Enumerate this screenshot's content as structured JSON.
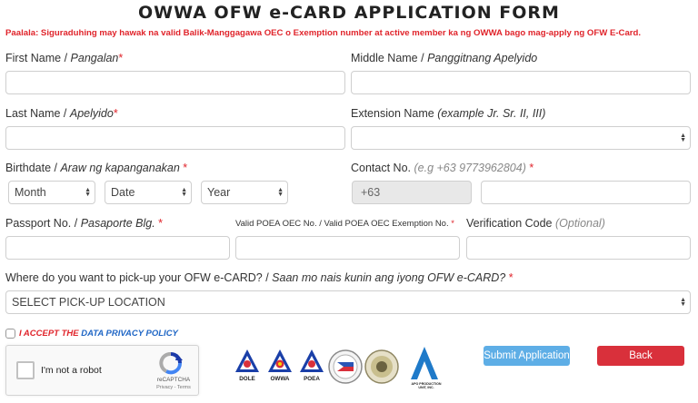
{
  "form": {
    "title": "OWWA OFW e-CARD APPLICATION FORM",
    "notice": "Paalala: Siguraduhing may hawak na valid Balik-Manggagawa OEC o Exemption number at active member ka ng OWWA bago mag-apply ng OFW E-Card."
  },
  "fields": {
    "first_name": {
      "label": "First Name / ",
      "label_tl": "Pangalan",
      "required": "*",
      "value": ""
    },
    "middle_name": {
      "label": "Middle Name / ",
      "label_tl": "Panggitnang Apelyido",
      "value": ""
    },
    "last_name": {
      "label": "Last Name / ",
      "label_tl": "Apelyido",
      "required": "*",
      "value": ""
    },
    "extension_name": {
      "label": "Extension Name ",
      "label_tl": "(example Jr. Sr. II, III)",
      "value": ""
    },
    "birthdate": {
      "label": "Birthdate / ",
      "label_tl": "Araw ng kapanganakan",
      "required": "*",
      "month": "Month",
      "day": "Date",
      "year": "Year"
    },
    "contact": {
      "label": "Contact No. ",
      "hint": "(e.g +63 9773962804)",
      "required": "*",
      "prefix": "+63",
      "value": ""
    },
    "passport": {
      "label": "Passport No. / ",
      "label_tl": "Pasaporte Blg.",
      "required": "*",
      "value": ""
    },
    "oec": {
      "label": "Valid POEA OEC No. / Valid POEA OEC Exemption No.",
      "required": "*",
      "value": ""
    },
    "verification": {
      "label": "Verification Code ",
      "hint": "(Optional)",
      "value": ""
    },
    "pickup": {
      "label": "Where do you want to pick-up your OFW e-CARD? / ",
      "label_tl": "Saan mo nais kunin ang iyong OFW e-CARD?",
      "required": "*",
      "selected": "SELECT PICK-UP LOCATION"
    }
  },
  "privacy": {
    "prefix": "I ACCEPT THE ",
    "link": "DATA PRIVACY POLICY"
  },
  "recaptcha": {
    "label": "I'm not a robot",
    "brand": "reCAPTCHA",
    "terms": "Privacy - Terms"
  },
  "logos": {
    "dole": "DOLE",
    "owwa": "OWWA",
    "poea": "POEA",
    "apo": "APO PRODUCTION UNIT, INC."
  },
  "buttons": {
    "submit": "Submit Application",
    "back": "Back"
  },
  "colors": {
    "required": "#e0242b",
    "link": "#1f66c5",
    "submit": "#5eaee6",
    "back": "#d9303b"
  }
}
